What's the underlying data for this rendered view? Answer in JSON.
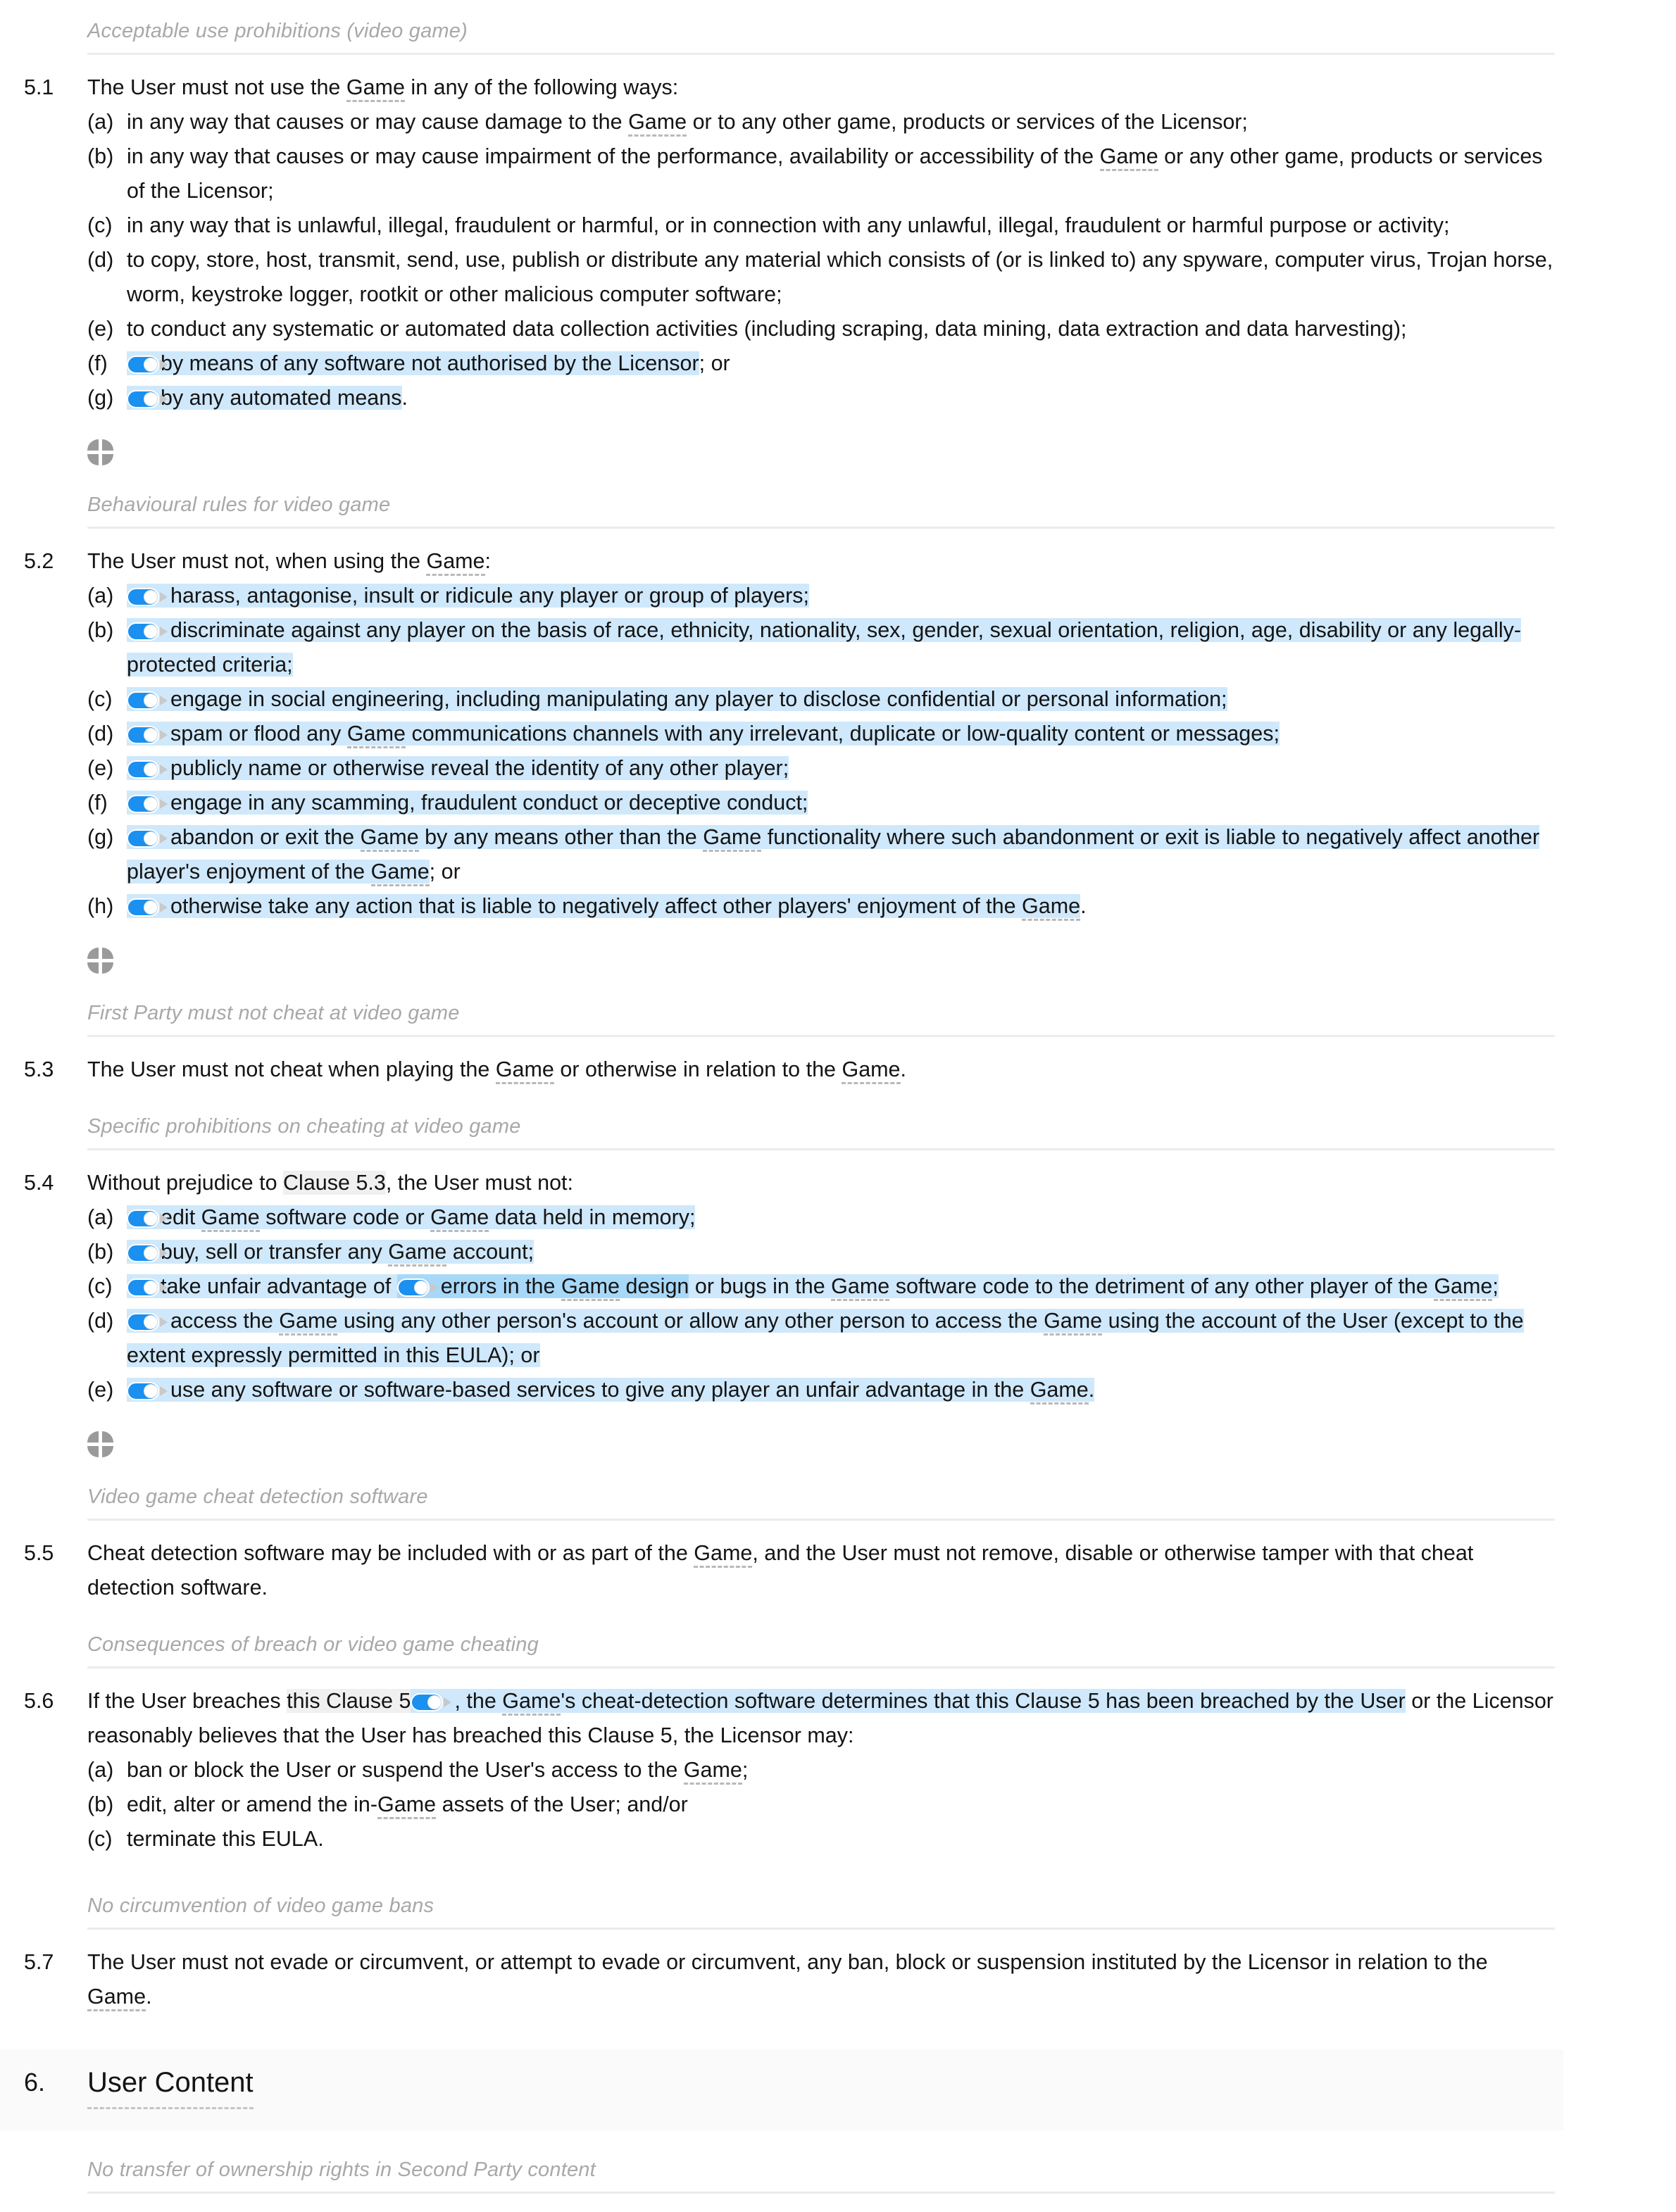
{
  "document": {
    "type": "eula-clause-page",
    "accent_color": "#1a90f0",
    "highlight_color": "#cfe8fb",
    "highlight_deep_color": "#a8d8f8",
    "xref_highlight_color": "#f0f0f0",
    "heading_color": "#a8a8a8",
    "rule_color": "#ececec"
  },
  "headings": {
    "acceptable_use": "Acceptable use prohibitions (video game)",
    "behavioural": "Behavioural rules for video game",
    "first_party_cheat": "First Party must not cheat at video game",
    "specific_cheating": "Specific prohibitions on cheating at video game",
    "cheat_detection": "Video game cheat detection software",
    "consequences": "Consequences of breach or video game cheating",
    "no_circumvention": "No circumvention of video game bans",
    "no_transfer": "No transfer of ownership rights in Second Party content"
  },
  "clauses": {
    "c51": {
      "number": "5.1",
      "lead": "The User must not use the Game in any of the following ways:",
      "items": [
        {
          "marker": "(a)",
          "text": "in any way that causes or may cause damage to the Game or to any other game, products or services of the Licensor;"
        },
        {
          "marker": "(b)",
          "text": "in any way that causes or may cause impairment of the performance, availability or accessibility of the Game or any other game, products or services of the Licensor;"
        },
        {
          "marker": "(c)",
          "text": "in any way that is unlawful, illegal, fraudulent or harmful, or in connection with any unlawful, illegal, fraudulent or harmful purpose or activity;"
        },
        {
          "marker": "(d)",
          "text": "to copy, store, host, transmit, send, use, publish or distribute any material which consists of (or is linked to) any spyware, computer virus, Trojan horse, worm, keystroke logger, rootkit or other malicious computer software;"
        },
        {
          "marker": "(e)",
          "text": "to conduct any systematic or automated data collection activities (including scraping, data mining, data extraction and data harvesting);"
        },
        {
          "marker": "(f)",
          "text": "by means of any software not authorised by the Licensor",
          "toggle": true,
          "suffix": "; or"
        },
        {
          "marker": "(g)",
          "text": "by any automated means",
          "toggle": true,
          "suffix": "."
        }
      ]
    },
    "c52": {
      "number": "5.2",
      "lead": "The User must not, when using the Game:",
      "items": [
        {
          "marker": "(a)",
          "toggle": true,
          "text": "harass, antagonise, insult or ridicule any player or group of players;"
        },
        {
          "marker": "(b)",
          "toggle": true,
          "text": "discriminate against any player on the basis of race, ethnicity, nationality, sex, gender, sexual orientation, religion, age, disability or any legally-protected criteria;"
        },
        {
          "marker": "(c)",
          "toggle": true,
          "text": "engage in social engineering, including manipulating any player to disclose confidential or personal information;"
        },
        {
          "marker": "(d)",
          "toggle": true,
          "text": "spam or flood any Game communications channels with any irrelevant, duplicate or low-quality content or messages;"
        },
        {
          "marker": "(e)",
          "toggle": true,
          "text": "publicly name or otherwise reveal the identity of any other player;"
        },
        {
          "marker": "(f)",
          "toggle": true,
          "text": "engage in any scamming, fraudulent conduct or deceptive conduct;"
        },
        {
          "marker": "(g)",
          "toggle": true,
          "text": "abandon or exit the Game by any means other than the Game functionality where such abandonment or exit is liable to negatively affect another player's enjoyment of the Game",
          "suffix": "; or"
        },
        {
          "marker": "(h)",
          "toggle": true,
          "text": "otherwise take any action that is liable to negatively affect other players' enjoyment of the Game",
          "suffix": "."
        }
      ]
    },
    "c53": {
      "number": "5.3",
      "text": "The User must not cheat when playing the Game or otherwise in relation to the Game."
    },
    "c54": {
      "number": "5.4",
      "lead_prefix": "Without prejudice to ",
      "lead_xref": "Clause 5.3",
      "lead_suffix": ", the User must not:",
      "items": [
        {
          "marker": "(a)",
          "toggle": true,
          "text": "edit Game software code or Game data held in memory;"
        },
        {
          "marker": "(b)",
          "toggle": true,
          "text": "buy, sell or transfer any Game account;"
        },
        {
          "marker": "(c)",
          "toggle": true,
          "text_before": "take unfair advantage of ",
          "inline_toggle": true,
          "text_deep": "errors in the Game design",
          "text_after": " or bugs in the Game software code to the detriment of any other player of the Game;"
        },
        {
          "marker": "(d)",
          "toggle": true,
          "text": "access the Game using any other person's account or allow any other person to access the Game using the account of the User (except to the extent expressly permitted in this EULA); or"
        },
        {
          "marker": "(e)",
          "toggle": true,
          "text": "use any software or software-based services to give any player an unfair advantage in the Game."
        }
      ]
    },
    "c55": {
      "number": "5.5",
      "text": "Cheat detection software may be included with or as part of the Game, and the User must not remove, disable or otherwise tamper with that cheat detection software."
    },
    "c56": {
      "number": "5.6",
      "lead_a": "If the User breaches ",
      "lead_xref": "this Clause 5",
      "lead_b": ", the Game's cheat-detection software determines that this Clause 5 has been breached by the User",
      "lead_c": " or the Licensor reasonably believes that the User has breached this Clause 5, the Licensor may:",
      "items": [
        {
          "marker": "(a)",
          "text": "ban or block the User or suspend the User's access to the Game;"
        },
        {
          "marker": "(b)",
          "text": "edit, alter or amend the in-Game assets of the User; and/or"
        },
        {
          "marker": "(c)",
          "text": "terminate this EULA."
        }
      ]
    },
    "c57": {
      "number": "5.7",
      "text": "The User must not evade or circumvent, or attempt to evade or circumvent, any ban, block or suspension instituted by the Licensor in relation to the Game."
    }
  },
  "section6": {
    "number": "6.",
    "title": "User Content"
  },
  "icons": {
    "quadrant_marker": "quadrant-circle-icon",
    "toggle_on": "toggle-switch-on-icon",
    "arrow_marker": "triangle-right-icon"
  }
}
